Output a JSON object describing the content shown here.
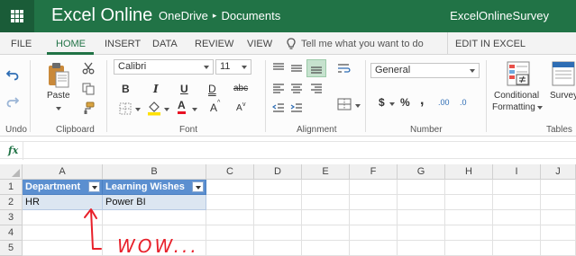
{
  "titlebar": {
    "app_name": "Excel Online",
    "breadcrumb_root": "OneDrive",
    "breadcrumb_separator": "▸",
    "breadcrumb_folder": "Documents",
    "document_title": "ExcelOnlineSurvey",
    "color": "#217346"
  },
  "tabs": {
    "items": [
      "FILE",
      "HOME",
      "INSERT",
      "DATA",
      "REVIEW",
      "VIEW"
    ],
    "active": "HOME",
    "tell_me_placeholder": "Tell me what you want to do",
    "edit_in_excel": "EDIT IN EXCEL"
  },
  "ribbon": {
    "undo_group": "Undo",
    "clipboard_group": "Clipboard",
    "paste_label": "Paste",
    "font_group": "Font",
    "font_name": "Calibri",
    "font_size": "11",
    "bold": "B",
    "italic": "I",
    "underline": "U",
    "double_underline": "D",
    "strikethrough": "abc",
    "grow_font": "A",
    "shrink_font": "A",
    "font_color": "A",
    "alignment_group": "Alignment",
    "number_group": "Number",
    "number_format": "General",
    "currency_symbol": "$",
    "percent_symbol": "%",
    "comma_symbol": ",",
    "increase_decimal": ".00",
    "decrease_decimal": ".0",
    "conditional_formatting_line1": "Conditional",
    "conditional_formatting_line2": "Formatting",
    "survey_label": "Survey",
    "tables_group": "Tables"
  },
  "formula_bar": {
    "fx_label": "fx",
    "value": ""
  },
  "sheet": {
    "columns": [
      "A",
      "B",
      "C",
      "D",
      "E",
      "F",
      "G",
      "H",
      "I",
      "J"
    ],
    "rows": [
      "1",
      "2",
      "3",
      "4",
      "5"
    ],
    "table_header": [
      "Department",
      "Learning Wishes"
    ],
    "table_row": [
      "HR",
      "Power BI"
    ],
    "header_fill": "#5b8fd0",
    "band_fill": "#dce6f1"
  },
  "annotation": {
    "text": "WOW...",
    "color": "#e8202a"
  }
}
